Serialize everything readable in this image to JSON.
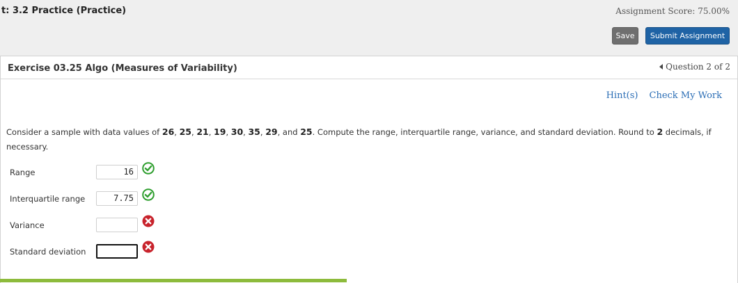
{
  "header": {
    "assignment_title": "t: 3.2 Practice (Practice)",
    "score": "Assignment Score: 75.00%",
    "save_label": "Save",
    "submit_label": "Submit Assignment"
  },
  "exercise": {
    "title": "Exercise 03.25 Algo (Measures of Variability)",
    "question_nav": "Question 2 of 2",
    "hint_label": "Hint(s)",
    "check_label": "Check My Work",
    "prompt_before": "Consider a sample with data values of ",
    "data_values": [
      "26",
      "25",
      "21",
      "19",
      "30",
      "35",
      "29",
      "25"
    ],
    "prompt_after": ". Compute the range, interquartile range, variance, and standard deviation. Round to ",
    "round_digits": "2",
    "prompt_end": " decimals, if necessary."
  },
  "answers": [
    {
      "label": "Range",
      "value": "16",
      "status": "correct"
    },
    {
      "label": "Interquartile range",
      "value": "7.75",
      "status": "correct"
    },
    {
      "label": "Variance",
      "value": "",
      "status": "incorrect"
    },
    {
      "label": "Standard deviation",
      "value": "",
      "status": "incorrect"
    }
  ],
  "progress": {
    "fraction": 0.47
  },
  "colors": {
    "correct": "#2e9e2e",
    "incorrect": "#c8232c",
    "accent": "#1f63a5",
    "progress": "#8dbb3c"
  }
}
